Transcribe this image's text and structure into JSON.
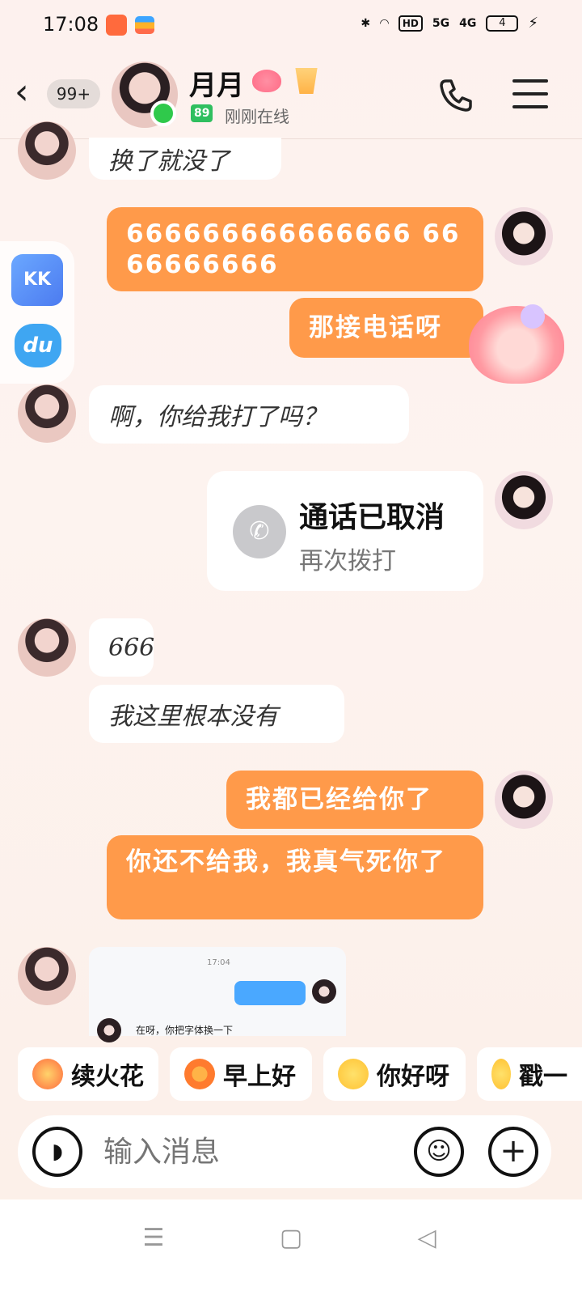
{
  "status_bar": {
    "time": "17:08",
    "icons": [
      "bluetooth-icon",
      "wifi-icon",
      "hd-icon",
      "signal-5g-icon",
      "signal-4g-icon",
      "battery-icon",
      "charging-icon"
    ],
    "hd": "HD",
    "net1": "5G",
    "net2": "4G",
    "battery": "4"
  },
  "header": {
    "back": "‹",
    "unread_count": "99+",
    "contact_name": "月月",
    "level": "89",
    "online_status": "刚刚在线"
  },
  "side_panel": {
    "app1": "KK",
    "app2": "du"
  },
  "messages": [
    {
      "side": "left",
      "text": "换了就没了"
    },
    {
      "side": "right",
      "text": "666666666666666 6666666666"
    },
    {
      "side": "right",
      "text": "那接电话呀"
    },
    {
      "side": "left",
      "text": "啊，你给我打了吗？"
    },
    {
      "side": "right",
      "type": "call",
      "title": "通话已取消",
      "action": "再次拨打"
    },
    {
      "side": "left",
      "text": "666"
    },
    {
      "side": "left",
      "text": "我这里根本没有"
    },
    {
      "side": "right",
      "text": "我都已经给你了"
    },
    {
      "side": "right",
      "text": "你还不给我，我真气死你了"
    },
    {
      "side": "left",
      "type": "image",
      "inner_time": "17:04",
      "inner_text": "在呀，你把字体换一下"
    }
  ],
  "quick_replies": [
    {
      "label": "续火花",
      "icon": "fire-face-icon"
    },
    {
      "label": "早上好",
      "icon": "sunflower-icon"
    },
    {
      "label": "你好呀",
      "icon": "laughing-face-icon"
    },
    {
      "label": "戳一",
      "icon": "smirk-face-icon"
    }
  ],
  "input": {
    "placeholder": "输入消息"
  },
  "colors": {
    "bubble_self": "#ff9a4a",
    "bubble_other": "#ffffff",
    "online": "#2fc94b",
    "background": "#fdf1ee"
  }
}
